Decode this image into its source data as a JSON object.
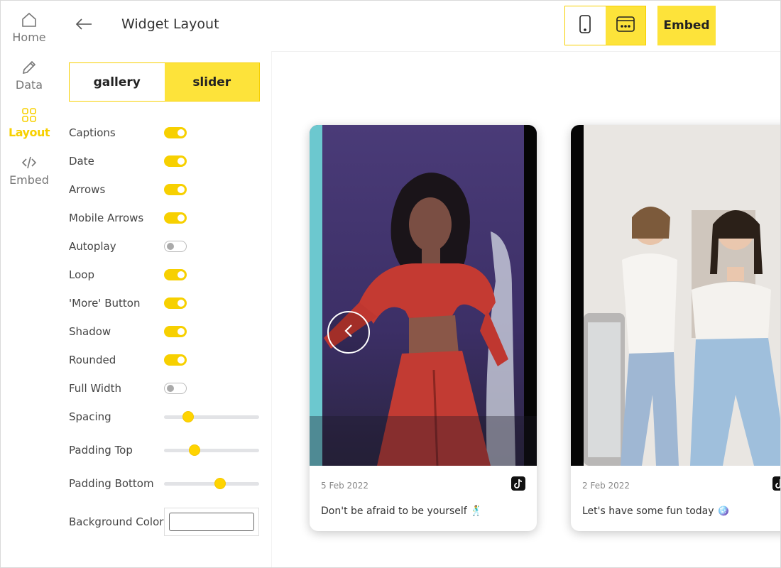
{
  "nav": {
    "items": [
      {
        "label": "Home",
        "icon": "home-icon",
        "active": false
      },
      {
        "label": "Data",
        "icon": "pencil-icon",
        "active": false
      },
      {
        "label": "Layout",
        "icon": "grid-icon",
        "active": true
      },
      {
        "label": "Embed",
        "icon": "code-icon",
        "active": false
      }
    ]
  },
  "header": {
    "title": "Widget Layout",
    "embed_label": "Embed"
  },
  "layout_mode": {
    "options": [
      "gallery",
      "slider"
    ],
    "selected": "slider"
  },
  "settings": {
    "toggles": [
      {
        "label": "Captions",
        "on": true
      },
      {
        "label": "Date",
        "on": true
      },
      {
        "label": "Arrows",
        "on": true
      },
      {
        "label": "Mobile Arrows",
        "on": true
      },
      {
        "label": "Autoplay",
        "on": false
      },
      {
        "label": "Loop",
        "on": true
      },
      {
        "label": "'More' Button",
        "on": true
      },
      {
        "label": "Shadow",
        "on": true
      },
      {
        "label": "Rounded",
        "on": true
      },
      {
        "label": "Full Width",
        "on": false
      }
    ],
    "sliders": [
      {
        "label": "Spacing",
        "value": 0.25
      },
      {
        "label": "Padding Top",
        "value": 0.32
      },
      {
        "label": "Padding Bottom",
        "value": 0.59
      }
    ],
    "background_color": {
      "label": "Background Color",
      "value": "#ffffff"
    }
  },
  "device_toggle": {
    "options": [
      "mobile",
      "desktop"
    ],
    "selected": "desktop"
  },
  "posts": [
    {
      "date": "5 Feb 2022",
      "caption": "Don't be afraid to be yourself 🕺"
    },
    {
      "date": "2 Feb 2022",
      "caption": "Let's have some fun today 🪩"
    }
  ],
  "colors": {
    "accent": "#f7d000",
    "accent_light": "#fde33a"
  }
}
